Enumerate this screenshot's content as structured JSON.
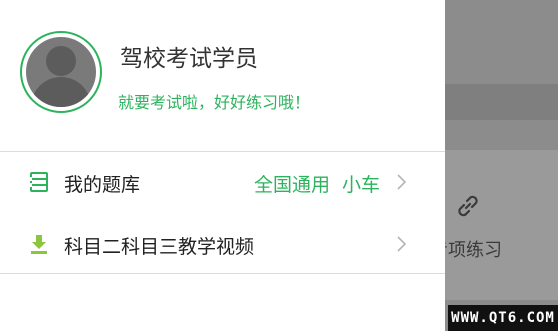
{
  "background": {
    "label": "专项练习",
    "icon": "link-icon"
  },
  "profile": {
    "name": "驾校考试学员",
    "slogan": "就要考试啦，好好练习哦！",
    "avatar_icon": "user-avatar-icon"
  },
  "menu": [
    {
      "label": "我的题库",
      "icon": "question-bank-icon",
      "value_region": "全国通用",
      "value_vehicle": "小车"
    },
    {
      "label": "科目二科目三教学视频",
      "icon": "download-icon"
    }
  ],
  "watermark": "WWW.QT6.COM",
  "colors": {
    "accent": "#2db35e",
    "divider": "#dcdcdc",
    "overlay": "#8c8c8c"
  }
}
